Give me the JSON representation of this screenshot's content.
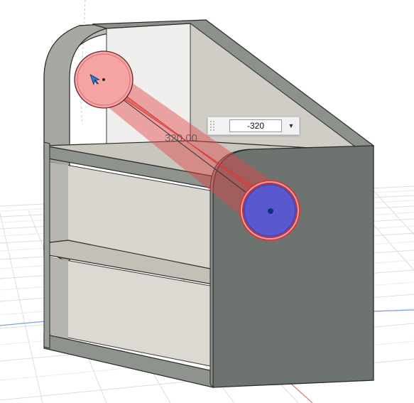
{
  "dimension": {
    "label": "320.00",
    "input_value": "-320"
  },
  "icons": {
    "dropdown": "chevron-down-icon",
    "start_point": "move-pin-icon",
    "end_point": "point-icon"
  },
  "colors": {
    "background": "#ffffff",
    "body_shade": "#6d7470",
    "body_light": "#a9aca6",
    "body_mid": "#c8c5bd",
    "extrude_red": "#e03a3a",
    "start_profile": "#f5a3a3",
    "end_profile": "#5a58cf",
    "grid_line": "#d9d9d9",
    "axis_red": "#e06b6b",
    "axis_blue": "#6e8fe0"
  }
}
